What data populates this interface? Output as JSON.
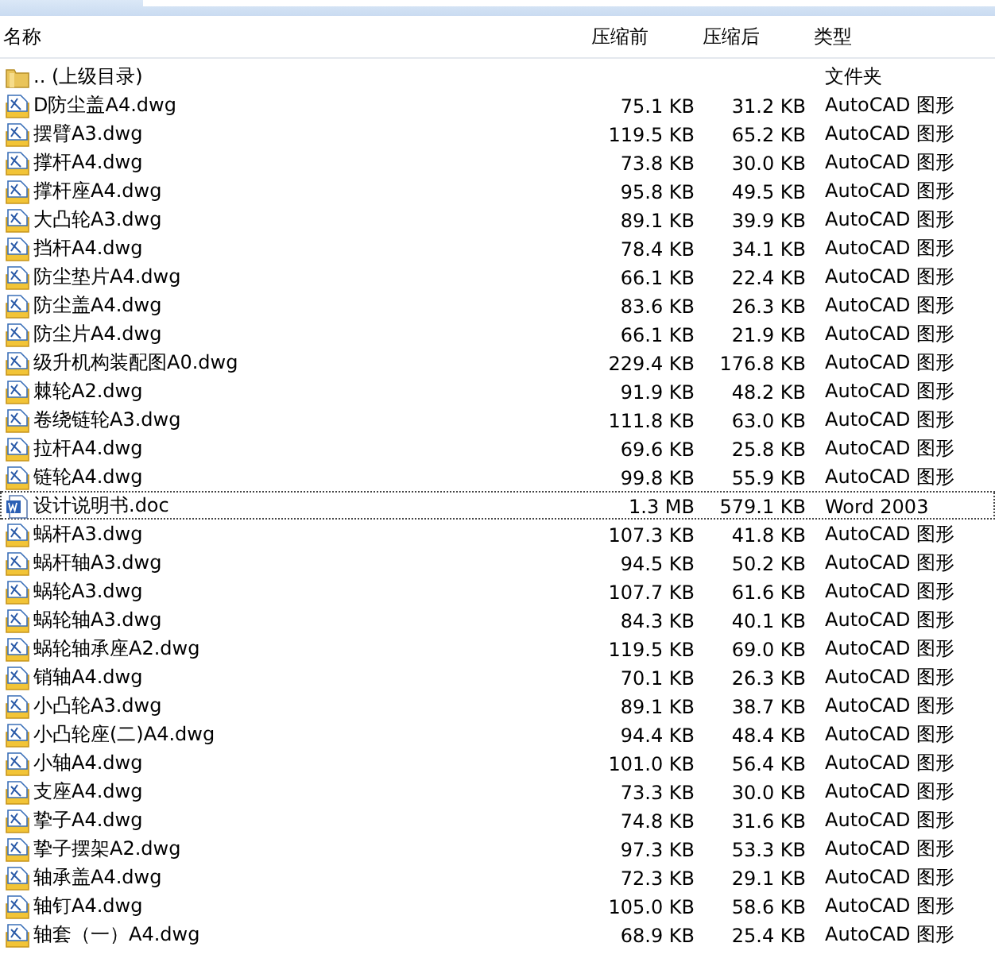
{
  "columns": [
    "名称",
    "压缩前",
    "压缩后",
    "类型"
  ],
  "rows": [
    {
      "kind": "folder",
      "name": ".. (上级目录)",
      "type": "文件夹",
      "focused": false
    },
    {
      "kind": "dwg",
      "name": "D防尘盖A4.dwg",
      "before": "75.1 KB",
      "after": "31.2 KB",
      "type": "AutoCAD 图形",
      "focused": false
    },
    {
      "kind": "dwg",
      "name": "摆臂A3.dwg",
      "before": "119.5 KB",
      "after": "65.2 KB",
      "type": "AutoCAD 图形",
      "focused": false
    },
    {
      "kind": "dwg",
      "name": "撑杆A4.dwg",
      "before": "73.8 KB",
      "after": "30.0 KB",
      "type": "AutoCAD 图形",
      "focused": false
    },
    {
      "kind": "dwg",
      "name": "撑杆座A4.dwg",
      "before": "95.8 KB",
      "after": "49.5 KB",
      "type": "AutoCAD 图形",
      "focused": false
    },
    {
      "kind": "dwg",
      "name": "大凸轮A3.dwg",
      "before": "89.1 KB",
      "after": "39.9 KB",
      "type": "AutoCAD 图形",
      "focused": false
    },
    {
      "kind": "dwg",
      "name": "挡杆A4.dwg",
      "before": "78.4 KB",
      "after": "34.1 KB",
      "type": "AutoCAD 图形",
      "focused": false
    },
    {
      "kind": "dwg",
      "name": "防尘垫片A4.dwg",
      "before": "66.1 KB",
      "after": "22.4 KB",
      "type": "AutoCAD 图形",
      "focused": false
    },
    {
      "kind": "dwg",
      "name": "防尘盖A4.dwg",
      "before": "83.6 KB",
      "after": "26.3 KB",
      "type": "AutoCAD 图形",
      "focused": false
    },
    {
      "kind": "dwg",
      "name": "防尘片A4.dwg",
      "before": "66.1 KB",
      "after": "21.9 KB",
      "type": "AutoCAD 图形",
      "focused": false
    },
    {
      "kind": "dwg",
      "name": "级升机构装配图A0.dwg",
      "before": "229.4 KB",
      "after": "176.8 KB",
      "type": "AutoCAD 图形",
      "focused": false
    },
    {
      "kind": "dwg",
      "name": "棘轮A2.dwg",
      "before": "91.9 KB",
      "after": "48.2 KB",
      "type": "AutoCAD 图形",
      "focused": false
    },
    {
      "kind": "dwg",
      "name": "卷绕链轮A3.dwg",
      "before": "111.8 KB",
      "after": "63.0 KB",
      "type": "AutoCAD 图形",
      "focused": false
    },
    {
      "kind": "dwg",
      "name": "拉杆A4.dwg",
      "before": "69.6 KB",
      "after": "25.8 KB",
      "type": "AutoCAD 图形",
      "focused": false
    },
    {
      "kind": "dwg",
      "name": "链轮A4.dwg",
      "before": "99.8 KB",
      "after": "55.9 KB",
      "type": "AutoCAD 图形",
      "focused": false
    },
    {
      "kind": "doc",
      "name": "设计说明书.doc",
      "before": "1.3 MB",
      "after": "579.1 KB",
      "type": "Word 2003",
      "focused": true
    },
    {
      "kind": "dwg",
      "name": "蜗杆A3.dwg",
      "before": "107.3 KB",
      "after": "41.8 KB",
      "type": "AutoCAD 图形",
      "focused": false
    },
    {
      "kind": "dwg",
      "name": "蜗杆轴A3.dwg",
      "before": "94.5 KB",
      "after": "50.2 KB",
      "type": "AutoCAD 图形",
      "focused": false
    },
    {
      "kind": "dwg",
      "name": "蜗轮A3.dwg",
      "before": "107.7 KB",
      "after": "61.6 KB",
      "type": "AutoCAD 图形",
      "focused": false
    },
    {
      "kind": "dwg",
      "name": "蜗轮轴A3.dwg",
      "before": "84.3 KB",
      "after": "40.1 KB",
      "type": "AutoCAD 图形",
      "focused": false
    },
    {
      "kind": "dwg",
      "name": "蜗轮轴承座A2.dwg",
      "before": "119.5 KB",
      "after": "69.0 KB",
      "type": "AutoCAD 图形",
      "focused": false
    },
    {
      "kind": "dwg",
      "name": "销轴A4.dwg",
      "before": "70.1 KB",
      "after": "26.3 KB",
      "type": "AutoCAD 图形",
      "focused": false
    },
    {
      "kind": "dwg",
      "name": "小凸轮A3.dwg",
      "before": "89.1 KB",
      "after": "38.7 KB",
      "type": "AutoCAD 图形",
      "focused": false
    },
    {
      "kind": "dwg",
      "name": "小凸轮座(二)A4.dwg",
      "before": "94.4 KB",
      "after": "48.4 KB",
      "type": "AutoCAD 图形",
      "focused": false
    },
    {
      "kind": "dwg",
      "name": "小轴A4.dwg",
      "before": "101.0 KB",
      "after": "56.4 KB",
      "type": "AutoCAD 图形",
      "focused": false
    },
    {
      "kind": "dwg",
      "name": "支座A4.dwg",
      "before": "73.3 KB",
      "after": "30.0 KB",
      "type": "AutoCAD 图形",
      "focused": false
    },
    {
      "kind": "dwg",
      "name": "挚子A4.dwg",
      "before": "74.8 KB",
      "after": "31.6 KB",
      "type": "AutoCAD 图形",
      "focused": false
    },
    {
      "kind": "dwg",
      "name": "挚子摆架A2.dwg",
      "before": "97.3 KB",
      "after": "53.3 KB",
      "type": "AutoCAD 图形",
      "focused": false
    },
    {
      "kind": "dwg",
      "name": "轴承盖A4.dwg",
      "before": "72.3 KB",
      "after": "29.1 KB",
      "type": "AutoCAD 图形",
      "focused": false
    },
    {
      "kind": "dwg",
      "name": "轴钉A4.dwg",
      "before": "105.0 KB",
      "after": "58.6 KB",
      "type": "AutoCAD 图形",
      "focused": false
    },
    {
      "kind": "dwg",
      "name": "轴套（一）A4.dwg",
      "before": "68.9 KB",
      "after": "25.4 KB",
      "type": "AutoCAD 图形",
      "focused": false
    }
  ]
}
